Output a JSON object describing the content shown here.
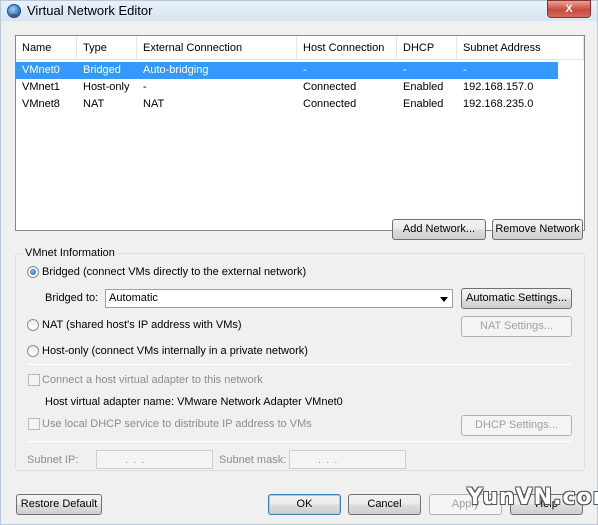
{
  "window": {
    "title": "Virtual Network Editor",
    "close_label": "X"
  },
  "table": {
    "columns": [
      "Name",
      "Type",
      "External Connection",
      "Host Connection",
      "DHCP",
      "Subnet Address"
    ],
    "rows": [
      {
        "name": "VMnet0",
        "type": "Bridged",
        "external": "Auto-bridging",
        "host": "-",
        "dhcp": "-",
        "subnet": "-"
      },
      {
        "name": "VMnet1",
        "type": "Host-only",
        "external": "-",
        "host": "Connected",
        "dhcp": "Enabled",
        "subnet": "192.168.157.0"
      },
      {
        "name": "VMnet8",
        "type": "NAT",
        "external": "NAT",
        "host": "Connected",
        "dhcp": "Enabled",
        "subnet": "192.168.235.0"
      }
    ]
  },
  "buttons": {
    "add_network": "Add Network...",
    "remove_network": "Remove Network",
    "automatic_settings": "Automatic Settings...",
    "nat_settings": "NAT Settings...",
    "dhcp_settings": "DHCP Settings...",
    "restore_default": "Restore Default",
    "ok": "OK",
    "cancel": "Cancel",
    "apply": "Apply",
    "help": "Help"
  },
  "vmnet_info": {
    "group_label": "VMnet Information",
    "bridged_label": "Bridged (connect VMs directly to the external network)",
    "bridged_to_label": "Bridged to:",
    "bridged_to_value": "Automatic",
    "nat_label": "NAT (shared host's IP address with VMs)",
    "host_only_label": "Host-only (connect VMs internally in a private network)",
    "connect_adapter_label": "Connect a host virtual adapter to this network",
    "adapter_name_label": "Host virtual adapter name: VMware Network Adapter VMnet0",
    "use_dhcp_label": "Use local DHCP service to distribute IP address to VMs",
    "subnet_ip_label": "Subnet IP:",
    "subnet_mask_label": "Subnet mask:",
    "subnet_ip_value": ". . .",
    "subnet_mask_value": ". . ."
  },
  "watermark": "YunVN.com",
  "colors": {
    "selection": "#3399ff",
    "dialog_bg": "#f0f0f0"
  }
}
